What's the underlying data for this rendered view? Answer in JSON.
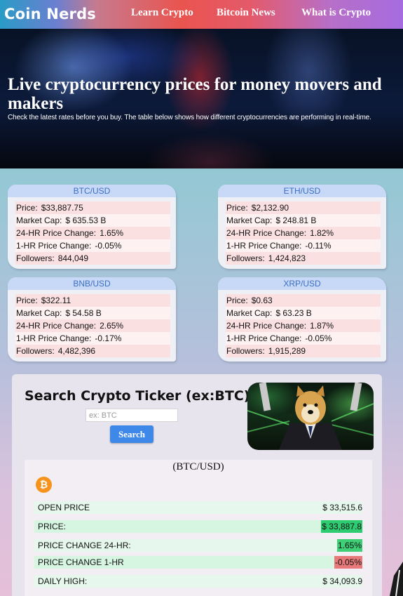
{
  "nav": {
    "brand": "Coin Nerds",
    "links": [
      "Learn Crypto",
      "Bitcoin News",
      "What is Crypto"
    ]
  },
  "hero": {
    "title": "Live cryptocurrency prices for money movers and makers",
    "subtitle": "Check the latest rates before you buy. The table below shows how different cryptocurrencies are performing in real-time."
  },
  "labels": {
    "price": "Price:",
    "market_cap": "Market Cap:",
    "change_24h": "24-HR Price Change:",
    "change_1h": "1-HR Price Change:",
    "followers": "Followers:"
  },
  "cards": [
    {
      "pair": "BTC/USD",
      "price": "$33,887.75",
      "market_cap": "$ 635.53 B",
      "change_24h": "1.65%",
      "change_1h": "-0.05%",
      "followers": "844,049"
    },
    {
      "pair": "ETH/USD",
      "price": "$2,132.90",
      "market_cap": "$ 248.81 B",
      "change_24h": "1.82%",
      "change_1h": "-0.11%",
      "followers": "1,424,823"
    },
    {
      "pair": "BNB/USD",
      "price": "$322.11",
      "market_cap": "$ 54.58 B",
      "change_24h": "2.65%",
      "change_1h": "-0.17%",
      "followers": "4,482,396"
    },
    {
      "pair": "XRP/USD",
      "price": "$0.63",
      "market_cap": "$ 63.23 B",
      "change_24h": "1.87%",
      "change_1h": "-0.05%",
      "followers": "1,915,289"
    }
  ],
  "search": {
    "title": "Search Crypto Ticker (ex:BTC)",
    "placeholder": "ex: BTC",
    "button": "Search"
  },
  "detail": {
    "pair": "(BTC/USD)",
    "coin_icon": "bitcoin-icon",
    "rows": [
      {
        "label": "OPEN PRICE",
        "value": "$ 33,515.6"
      },
      {
        "label": "PRICE:",
        "value": "$ 33,887.8"
      },
      {
        "label": "PRICE CHANGE 24-HR:",
        "value": "1.65%"
      },
      {
        "label": "PRICE CHANGE 1-HR",
        "value": "-0.05%"
      },
      {
        "label": "DAILY HIGH:",
        "value": "$ 34,093.9"
      }
    ]
  },
  "colors": {
    "positive": "#2ecc71",
    "negative": "#e8797a",
    "button": "#3e88ea",
    "card_header": "#c7d9f7"
  }
}
